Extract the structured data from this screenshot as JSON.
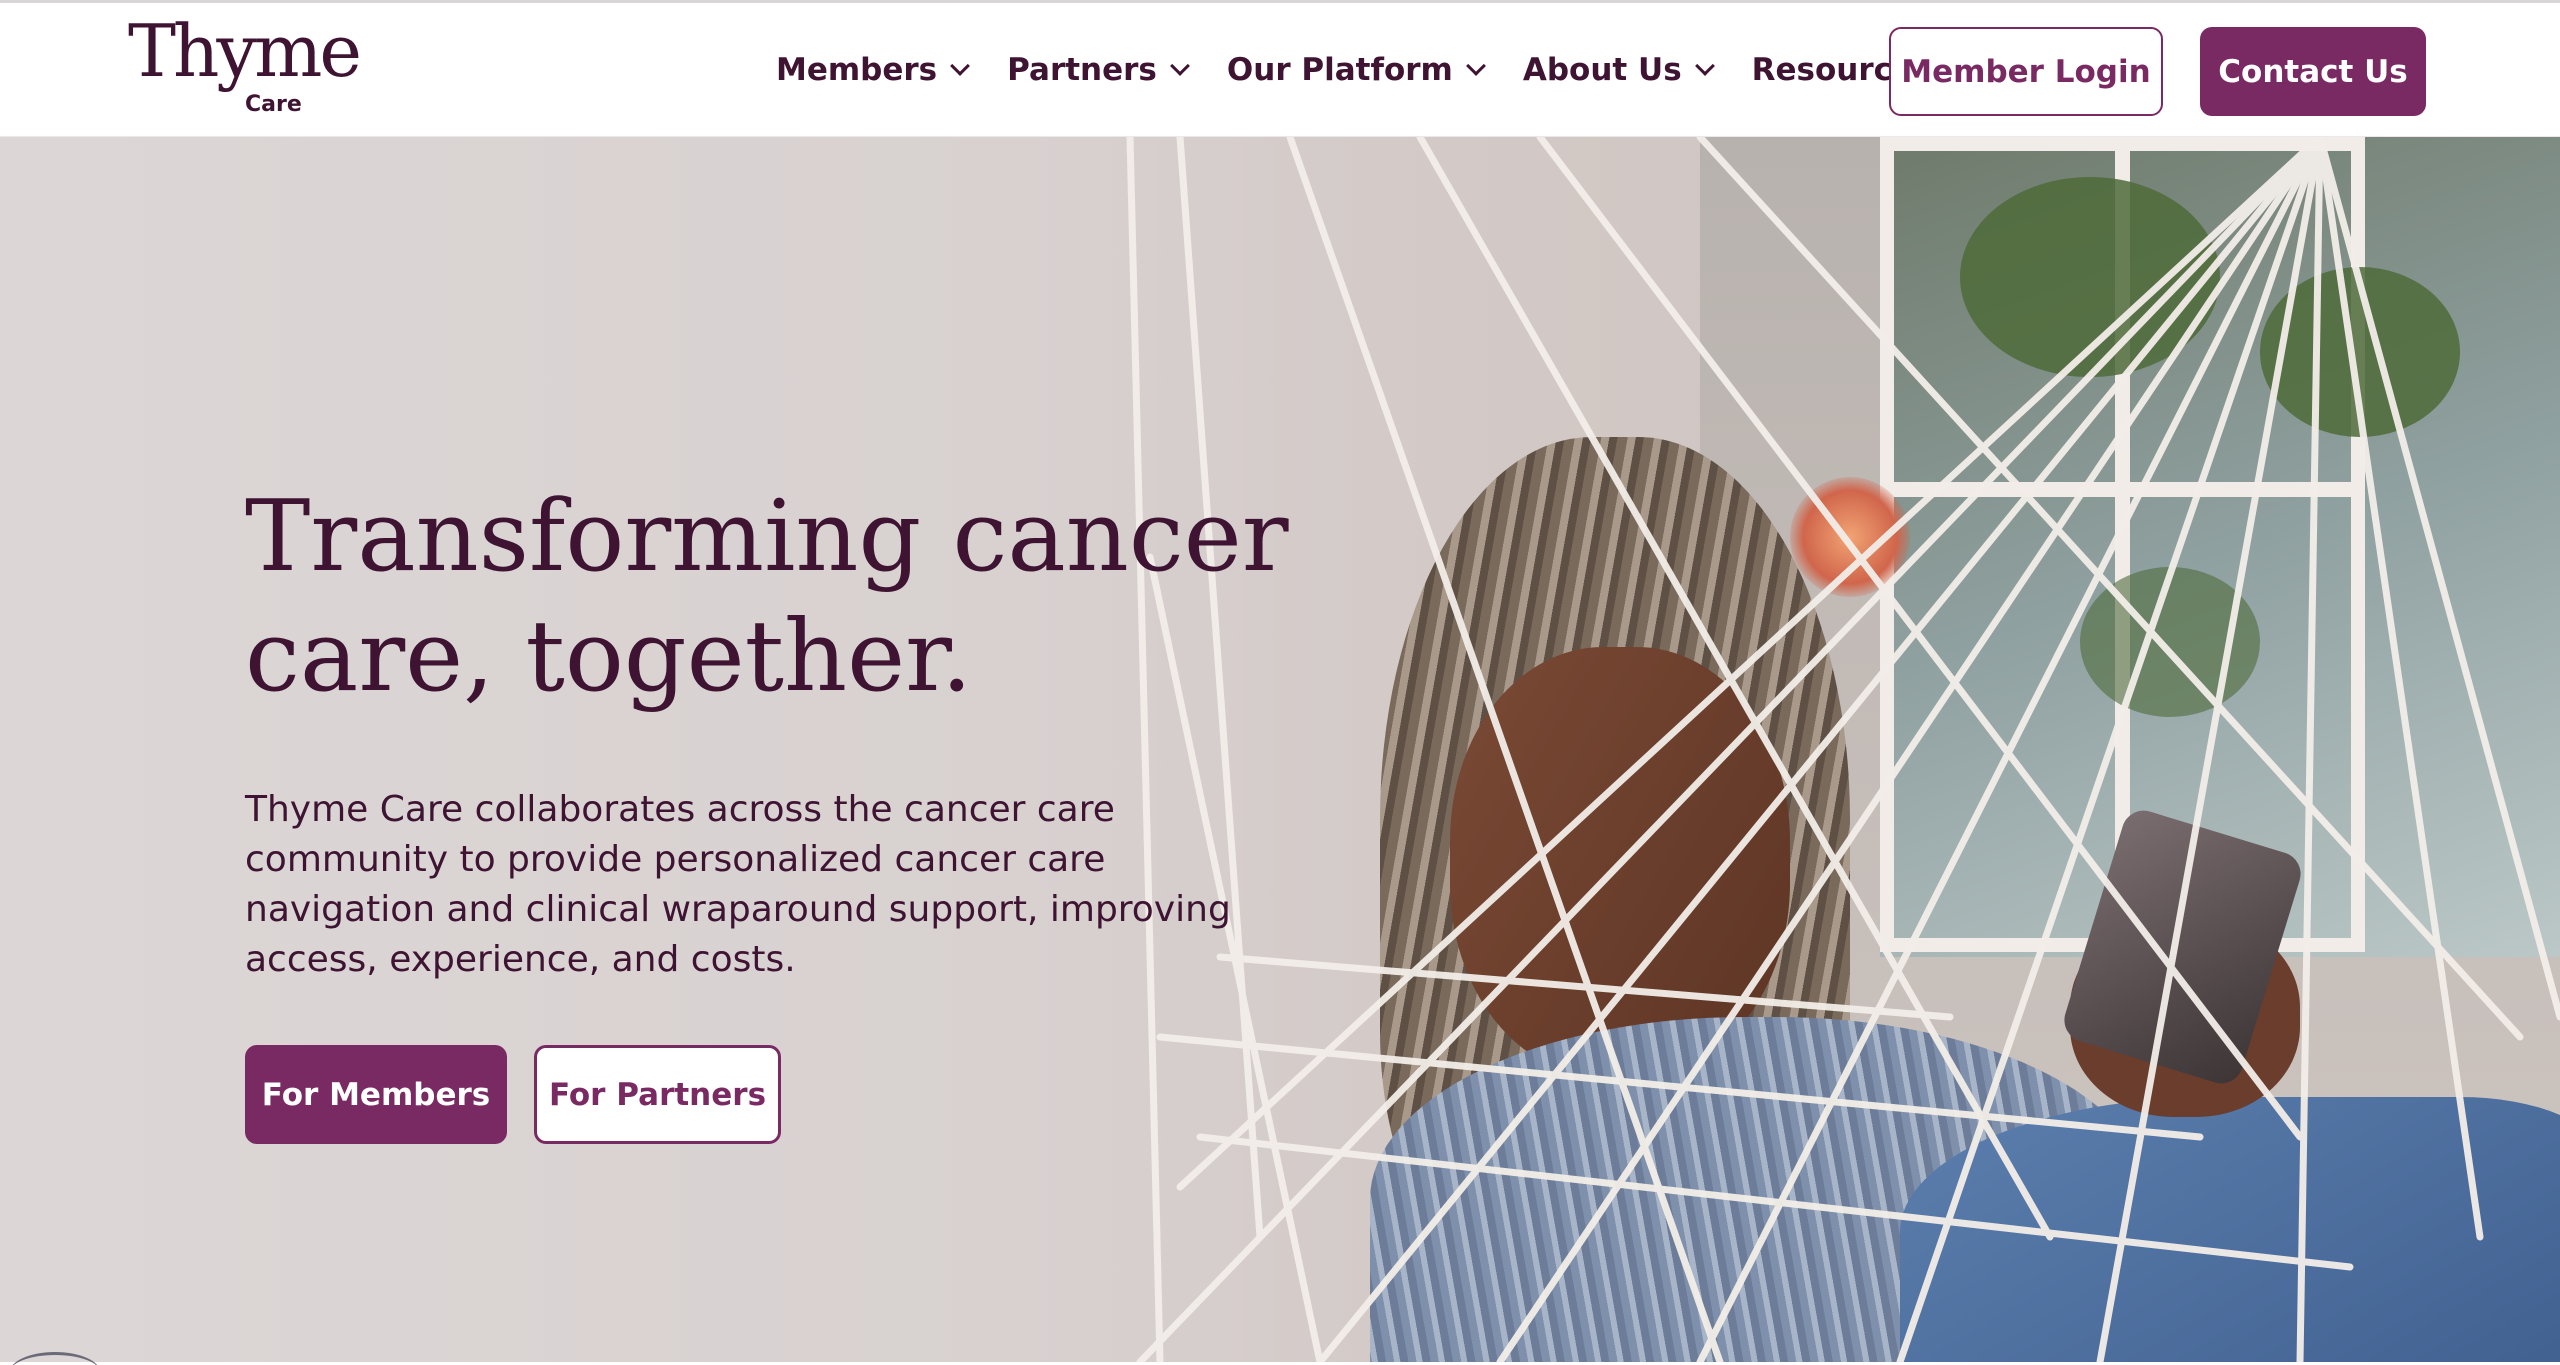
{
  "brand": {
    "wordmark": "Thyme",
    "sub": "Care",
    "accent_color": "#7a2a62",
    "text_color": "#3e1432"
  },
  "nav": {
    "items": [
      {
        "label": "Members",
        "icon": "chevron-down-icon"
      },
      {
        "label": "Partners",
        "icon": "chevron-down-icon"
      },
      {
        "label": "Our Platform",
        "icon": "chevron-down-icon"
      },
      {
        "label": "About Us",
        "icon": "chevron-down-icon"
      },
      {
        "label": "Resources",
        "icon": "chevron-down-icon"
      }
    ],
    "login_label": "Member Login",
    "contact_label": "Contact Us"
  },
  "hero": {
    "title_line1": "Transforming cancer",
    "title_line2": "care, together.",
    "description": "Thyme Care collaborates across the cancer care community to provide personalized cancer care navigation and clinical wraparound support, improving access, experience, and costs.",
    "primary_cta": "For Members",
    "secondary_cta": "For Partners",
    "image_subject": "woman-in-hammock-reading-phone"
  }
}
